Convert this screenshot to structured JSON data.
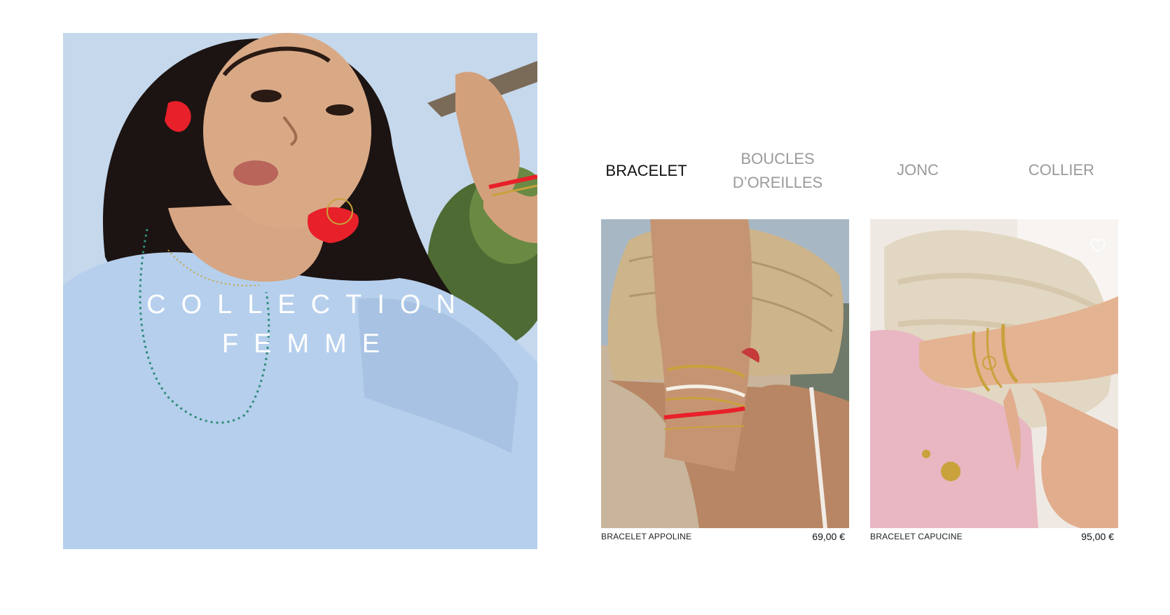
{
  "hero": {
    "title_line1": "COLLECTION",
    "title_line2": "FEMME"
  },
  "tabs": [
    {
      "label": "BRACELET",
      "active": true
    },
    {
      "label": "BOUCLES D’OREILLES",
      "active": false
    },
    {
      "label": "JONC",
      "active": false
    },
    {
      "label": "COLLIER",
      "active": false
    }
  ],
  "products": [
    {
      "name": "BRACELET APPOLINE",
      "price": "69,00 €"
    },
    {
      "name": "BRACELET CAPUCINE",
      "price": "95,00 €"
    }
  ],
  "icons": {
    "wishlist": "heart-icon"
  },
  "colors": {
    "active_tab": "#111111",
    "inactive_tab": "#9a9a9a",
    "accent_red": "#e8202a"
  }
}
